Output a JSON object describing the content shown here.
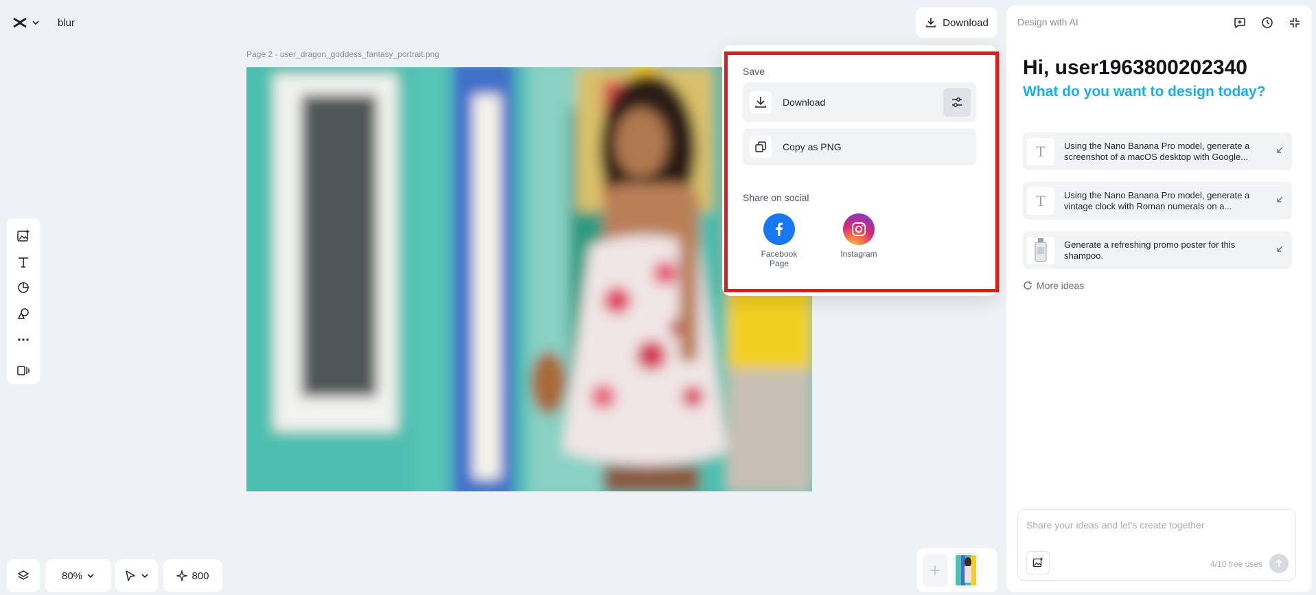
{
  "header": {
    "project_name": "blur",
    "download_label": "Download"
  },
  "canvas": {
    "page_label": "Page 2 -  user_dragon_goddess_fantasy_portrait.png"
  },
  "left_toolbar": {
    "tools": [
      "add-image-icon",
      "text-icon",
      "shapes-icon",
      "elements-icon",
      "more-icon",
      "device-icon"
    ]
  },
  "bottom": {
    "zoom": "80%",
    "credits": "800"
  },
  "dropdown": {
    "save_title": "Save",
    "download_label": "Download",
    "copy_label": "Copy as PNG",
    "share_title": "Share on social",
    "social": [
      {
        "label": "Facebook Page",
        "color": "#1877f2"
      },
      {
        "label": "Instagram",
        "color": "#d6297a"
      }
    ]
  },
  "right_panel": {
    "title": "Design with AI",
    "greeting": "Hi, user1963800202340",
    "subtitle": "What do you want to design today?",
    "ideas": [
      {
        "text": "Using the Nano Banana Pro model, generate a screenshot of a macOS desktop with Google...",
        "icon": "text-icon"
      },
      {
        "text": "Using the Nano Banana Pro model, generate a vintage clock with Roman numerals on a...",
        "icon": "text-icon"
      },
      {
        "text": "Generate a refreshing promo poster for this shampoo.",
        "icon": "shampoo-thumb"
      }
    ],
    "more_ideas": "More ideas",
    "chat_placeholder": "Share your ideas and let's create together",
    "free_uses": "4/10 free uses"
  },
  "colors": {
    "accent_blue": "#1aaee6",
    "highlight_red": "#dd1c1c",
    "background": "#eef1f5"
  }
}
